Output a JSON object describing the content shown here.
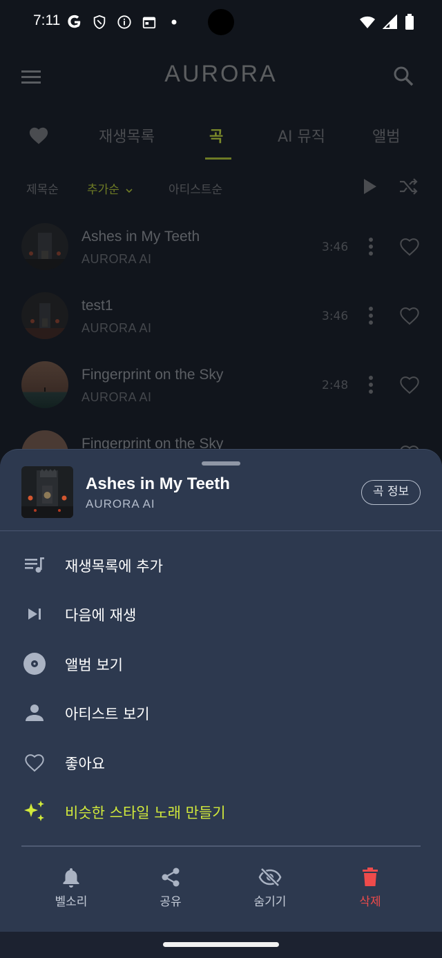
{
  "status_bar": {
    "time": "7:11",
    "left_icons": [
      "google-icon",
      "shield-icon",
      "info-icon",
      "calendar-icon",
      "dot-icon"
    ],
    "right_icons": [
      "wifi-icon",
      "signal-icon",
      "battery-icon"
    ]
  },
  "app": {
    "logo": "AURORA",
    "tabs": [
      {
        "label": "",
        "icon": "heart-icon"
      },
      {
        "label": "재생목록"
      },
      {
        "label": "곡",
        "active": true
      },
      {
        "label": "AI 뮤직"
      },
      {
        "label": "앨범"
      }
    ],
    "sort_options": [
      {
        "label": "제목순"
      },
      {
        "label": "추가순",
        "active": true
      },
      {
        "label": "아티스트순"
      }
    ],
    "songs": [
      {
        "title": "Ashes in My Teeth",
        "artist": "AURORA AI",
        "duration": "3:46"
      },
      {
        "title": "test1",
        "artist": "AURORA AI",
        "duration": "3:46"
      },
      {
        "title": "Fingerprint on the Sky",
        "artist": "AURORA AI",
        "duration": "2:48"
      },
      {
        "title": "Fingerprint on the Sky",
        "artist": "",
        "duration": ""
      }
    ]
  },
  "sheet": {
    "title": "Ashes in My Teeth",
    "artist": "AURORA AI",
    "info_button": "곡 정보",
    "menu": [
      {
        "label": "재생목록에 추가",
        "icon": "playlist-add-icon"
      },
      {
        "label": "다음에 재생",
        "icon": "play-next-icon"
      },
      {
        "label": "앨범 보기",
        "icon": "album-icon"
      },
      {
        "label": "아티스트 보기",
        "icon": "person-icon"
      },
      {
        "label": "좋아요",
        "icon": "heart-outline-icon"
      },
      {
        "label": "비슷한 스타일 노래 만들기",
        "icon": "sparkle-icon",
        "accent": "#d2ea3b"
      }
    ],
    "actions": [
      {
        "label": "벨소리",
        "icon": "bell-icon"
      },
      {
        "label": "공유",
        "icon": "share-icon"
      },
      {
        "label": "숨기기",
        "icon": "eye-off-icon"
      },
      {
        "label": "삭제",
        "icon": "trash-icon",
        "color": "#ee4b4b"
      }
    ]
  },
  "colors": {
    "sheet_bg": "#2d394f",
    "accent_lime": "#d2ea3b",
    "danger": "#ee4b4b"
  }
}
